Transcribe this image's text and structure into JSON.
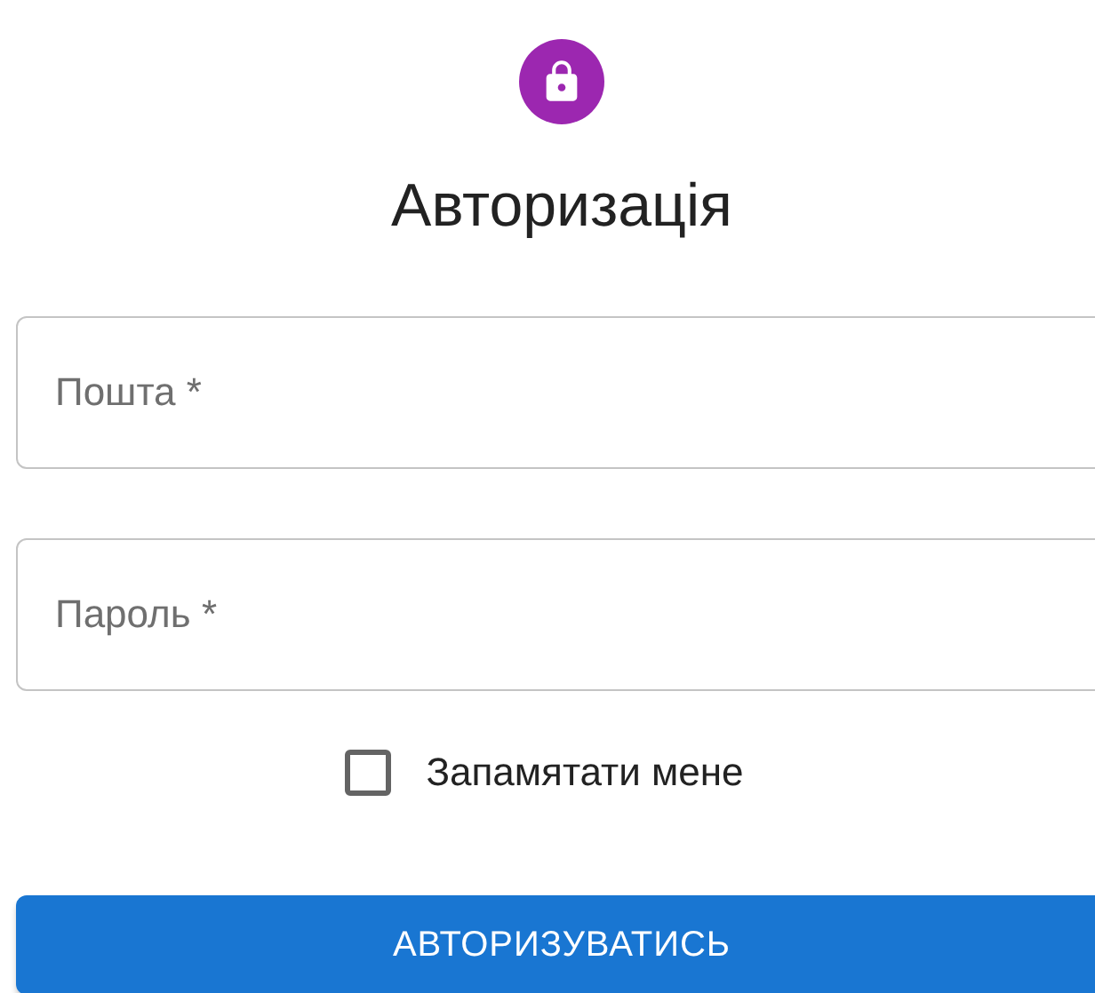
{
  "title": "Авторизація",
  "fields": [
    {
      "placeholder": "Пошта *"
    },
    {
      "placeholder": "Пароль *"
    }
  ],
  "remember": {
    "label": "Запамятати мене",
    "checked": false
  },
  "submit": "АВТОРИЗУВАТИСЬ"
}
